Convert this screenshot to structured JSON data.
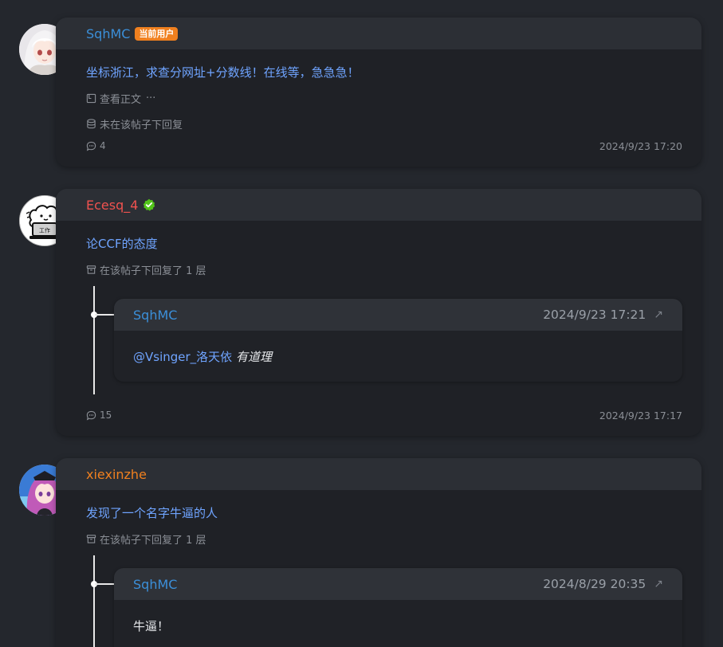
{
  "posts": [
    {
      "username": "SqhMC",
      "badge": "当前用户",
      "title": "坐标浙江，求查分网址+分数线！在线等，急急急！",
      "view_label": "查看正文",
      "more_label": "···",
      "reply_status": "未在该帖子下回复",
      "comments": "4",
      "time": "2024/9/23 17:20",
      "name_color": "#3b8fd9"
    },
    {
      "username": "Ecesq_4",
      "title": "论CCF的态度",
      "reply_status": "在该帖子下回复了 1 层",
      "comments": "15",
      "time": "2024/9/23 17:17",
      "name_color": "#f0524f",
      "reply": {
        "user": "SqhMC",
        "time": "2024/9/23 17:21",
        "mention": "@Vsinger_洛天依",
        "text": "有道理"
      }
    },
    {
      "username": "xiexinzhe",
      "title": "发现了一个名字牛逼的人",
      "reply_status": "在该帖子下回复了 1 层",
      "name_color": "#f0801f",
      "reply": {
        "user": "SqhMC",
        "time": "2024/8/29 20:35",
        "text": "牛逼！"
      }
    }
  ],
  "avatar_icon_text": "工作"
}
